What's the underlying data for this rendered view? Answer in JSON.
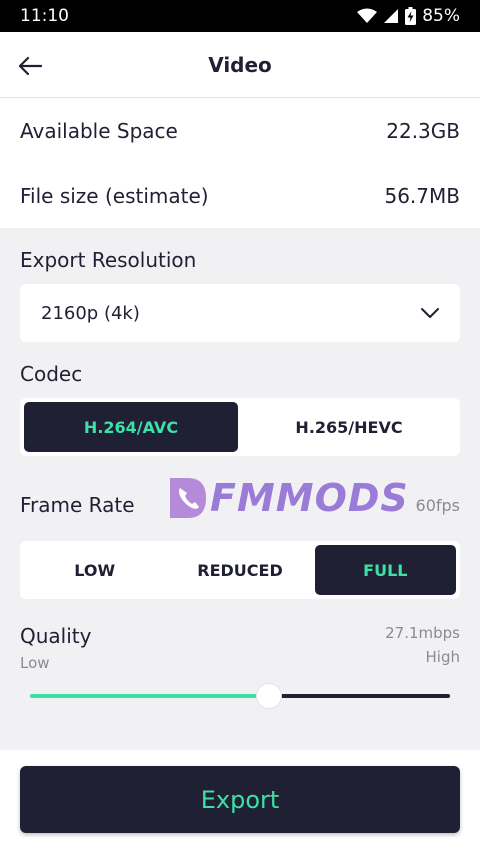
{
  "status_bar": {
    "time": "11:10",
    "battery": "85%"
  },
  "header": {
    "title": "Video"
  },
  "info": {
    "available_space_label": "Available Space",
    "available_space_value": "22.3GB",
    "file_size_label": "File size (estimate)",
    "file_size_value": "56.7MB"
  },
  "resolution": {
    "label": "Export Resolution",
    "selected": "2160p (4k)"
  },
  "codec": {
    "label": "Codec",
    "options": [
      "H.264/AVC",
      "H.265/HEVC"
    ],
    "selected_index": 0
  },
  "frame_rate": {
    "label": "Frame Rate",
    "value": "60fps",
    "options": [
      "LOW",
      "REDUCED",
      "FULL"
    ],
    "selected_index": 2
  },
  "watermark": {
    "text": "FMMODS"
  },
  "quality": {
    "label": "Quality",
    "bitrate": "27.1mbps",
    "low_label": "Low",
    "high_label": "High",
    "level": 0.57
  },
  "export": {
    "label": "Export"
  },
  "colors": {
    "accent": "#3de0a7",
    "dark": "#1f2033",
    "panel": "#f1f1f4",
    "muted": "#8a8a96"
  }
}
